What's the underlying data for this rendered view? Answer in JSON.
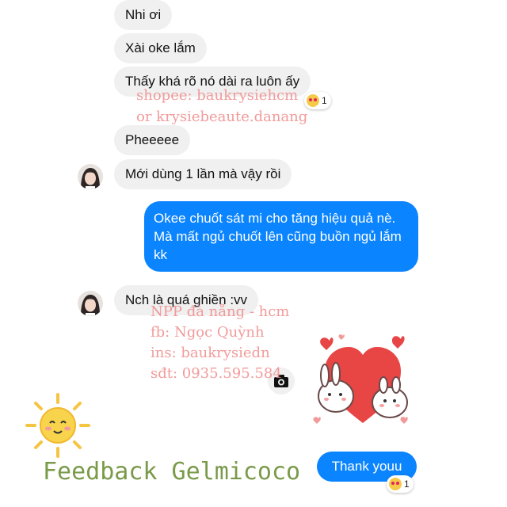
{
  "messages": [
    {
      "text": "Nhi ơi"
    },
    {
      "text": "Xài oke lắm"
    },
    {
      "text": "Thấy khá rõ nó dài ra luôn ấy"
    },
    {
      "text": "Pheeeee"
    },
    {
      "text": "Mới dùng 1 lần mà vậy rồi"
    },
    {
      "text": "Okee chuốt sát mi cho tăng hiệu quả nè. Mà mất ngủ chuốt lên cũng buồn ngủ lắm kk"
    },
    {
      "text": "Nch là quá ghiền :vv"
    },
    {
      "text": "Thank youu"
    }
  ],
  "reactions": [
    {
      "emoji": "heart-eyes",
      "count": "1"
    },
    {
      "emoji": "heart-eyes",
      "count": "1"
    }
  ],
  "watermarks": {
    "shop_line1": "shopee: baukrysiehcm",
    "shop_line2": "or krysiebeaute.danang",
    "npp_line1": "NPP đà nẵng - hcm",
    "npp_line2": "fb: Ngọc Quỳnh",
    "npp_line3": "ins: baukrysiedn",
    "npp_line4": "sđt: 0935.595.584"
  },
  "footer": {
    "title": "Feedback Gelmicoco"
  },
  "colors": {
    "outgoing": "#0a84ff",
    "incoming": "#f0f0f0",
    "watermark": "#f08a8a",
    "footer": "#7a9a4a"
  }
}
